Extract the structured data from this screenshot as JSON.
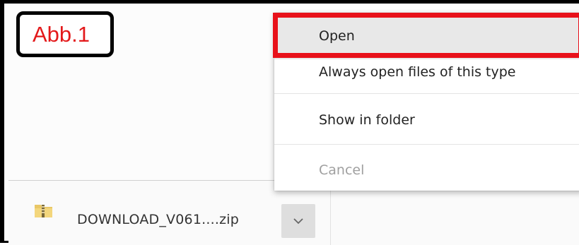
{
  "annotation": {
    "label": "Abb.1",
    "label_color": "#e3191b",
    "highlight_color": "#e8111a"
  },
  "download_bar": {
    "file_icon": "zip-folder-icon",
    "file_name": "DOWNLOAD_V061....zip",
    "menu_toggle_icon": "chevron-down-icon"
  },
  "context_menu": {
    "items": [
      {
        "label": "Open",
        "highlighted": true
      },
      {
        "label": "Always open files of this type"
      },
      {
        "label": "Show in folder"
      },
      {
        "label": "Cancel",
        "disabled": true
      }
    ]
  }
}
